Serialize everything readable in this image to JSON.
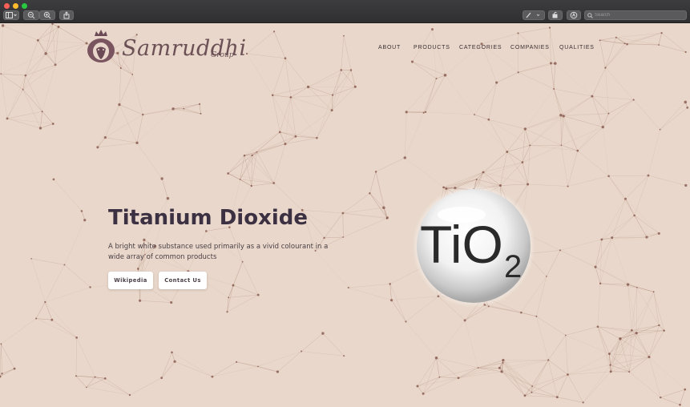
{
  "toolbar": {
    "search_placeholder": "Search"
  },
  "brand": {
    "name": "Samruddhi",
    "sub": "Group"
  },
  "nav": [
    "ABOUT",
    "PRODUCTS",
    "CATEGORIES",
    "COMPANIES",
    "QUALITIES"
  ],
  "hero": {
    "title": "Titanium Dioxide",
    "description": "A bright white substance used primarily as a vivid colourant in a wide array of common products",
    "buttons": [
      "Wikipedia",
      "Contact Us"
    ]
  },
  "formula": {
    "symbol": "TiO",
    "subscript": "2"
  },
  "colors": {
    "background": "#e8d7ca",
    "network": "#8f5a4a",
    "title": "#3c3142"
  }
}
